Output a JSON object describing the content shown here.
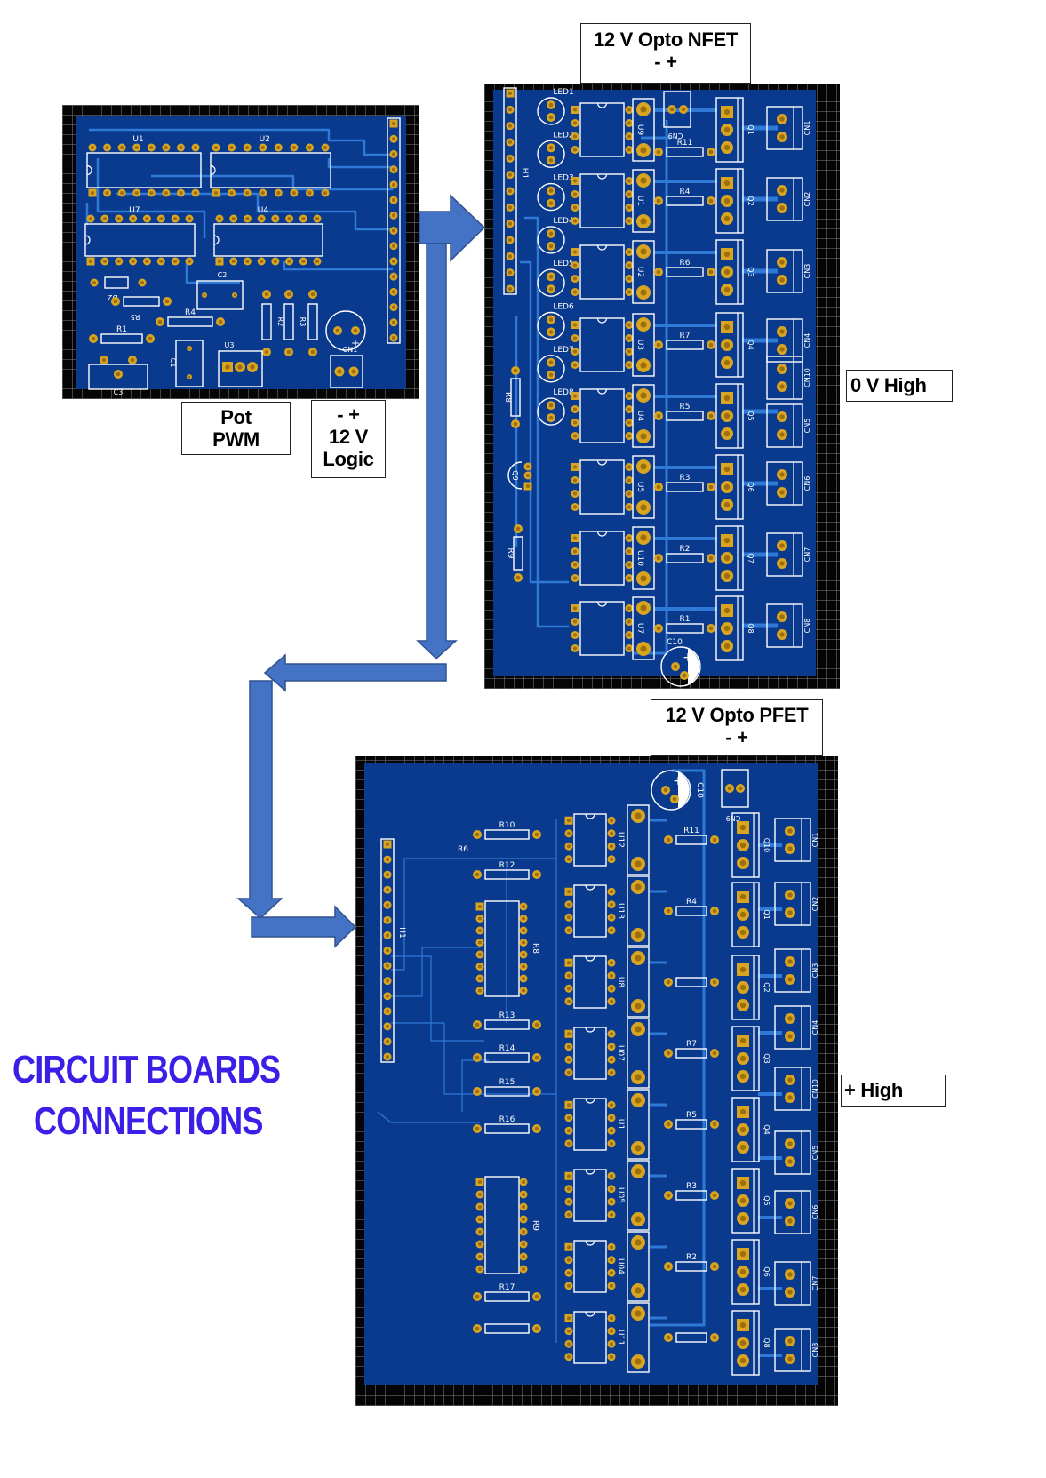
{
  "colors": {
    "board": "#0a3a8e",
    "trace": "#2e7ad6",
    "pad": "#d9a520",
    "silk": "#ffffff",
    "arrow": "#4472c4",
    "arrow_outline": "#2f528f",
    "title": "#3b1fe6"
  },
  "labels": {
    "nfet": {
      "line1": "12 V Opto NFET",
      "line2": "-  +"
    },
    "pfet": {
      "line1": "12 V Opto PFET",
      "line2": "-  +"
    },
    "pot": {
      "line1": "Pot",
      "line2": "PWM"
    },
    "logic": {
      "line1": "-  +",
      "line2": "12 V",
      "line3": "Logic"
    },
    "zero_high": "0 V High",
    "plus_high": "+ High"
  },
  "title": {
    "line1": "CIRCUIT BOARDS",
    "line2": "CONNECTIONS"
  },
  "boards": {
    "logic": {
      "ics": [
        "U1",
        "U2",
        "U7",
        "U4"
      ],
      "parts": [
        "D2",
        "R5",
        "R4",
        "R1",
        "C2",
        "R2",
        "R3",
        "C1",
        "U3",
        "CN1",
        "C3"
      ]
    },
    "nfet": {
      "header": "H1",
      "leds": [
        "LED1",
        "LED2",
        "LED3",
        "LED4",
        "LED5",
        "LED6",
        "LED7",
        "LED8"
      ],
      "optos": [
        "U9",
        "U1",
        "U2",
        "U3",
        "U4",
        "U5",
        "U10",
        "U7"
      ],
      "resistors": [
        "R11",
        "R4",
        "R6",
        "R7",
        "R5",
        "R3",
        "R2",
        "R1"
      ],
      "fets": [
        "Q1",
        "Q2",
        "Q3",
        "Q4",
        "Q5",
        "Q6",
        "Q7",
        "Q8"
      ],
      "connectors": [
        "CN1",
        "CN2",
        "CN3",
        "CN4",
        "CN10",
        "CN5",
        "CN6",
        "CN7",
        "CN8"
      ],
      "extras": {
        "r8": "R8",
        "q9": "Q9",
        "r9": "R9",
        "c10": "C10",
        "cn9": "CN9"
      }
    },
    "pfet": {
      "header": "H1",
      "left_resistors": [
        "R10",
        "R12",
        "R13",
        "R14",
        "R15",
        "R16",
        "R17",
        ""
      ],
      "r6": "R6",
      "dips": [
        "R8",
        "R9"
      ],
      "optos": [
        "U12",
        "U13",
        "U8",
        "U07",
        "U1",
        "U05",
        "U04",
        "U11"
      ],
      "resistors": [
        "R11",
        "R4",
        "",
        "R7",
        "R5",
        "R3",
        "R2",
        ""
      ],
      "fets": [
        "Q10",
        "Q1",
        "Q2",
        "Q3",
        "Q4",
        "Q5",
        "Q6",
        "Q8"
      ],
      "connectors": [
        "CN1",
        "CN2",
        "CN3",
        "CN4",
        "CN10",
        "CN5",
        "CN6",
        "CN7",
        "CN8"
      ],
      "extras": {
        "c10": "C10",
        "cn9": "CN9"
      }
    }
  }
}
